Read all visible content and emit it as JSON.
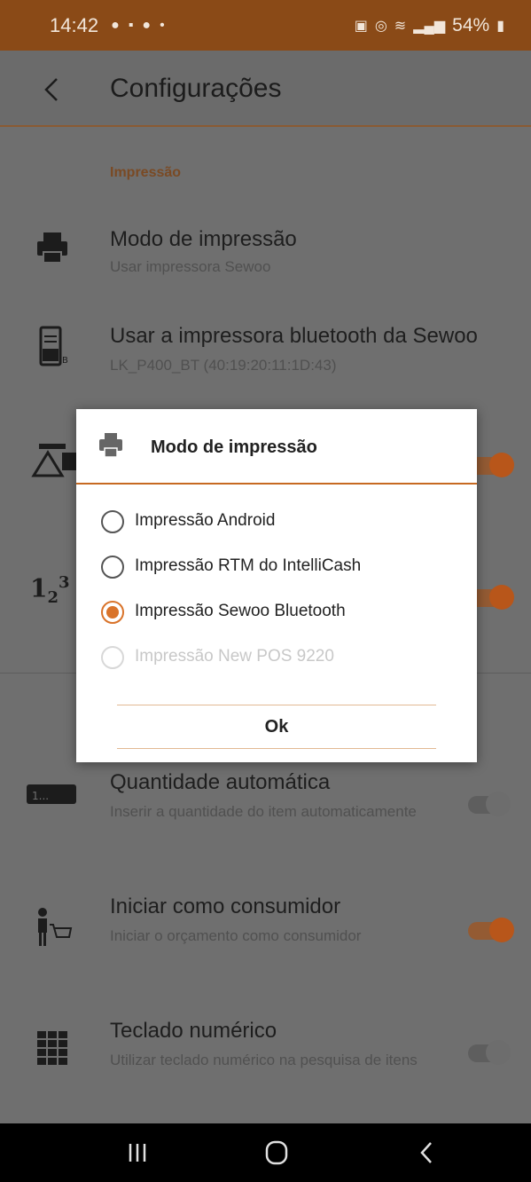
{
  "status_bar": {
    "time": "14:42",
    "battery": "54%"
  },
  "app_bar": {
    "title": "Configurações"
  },
  "section": {
    "header": "Impressão"
  },
  "settings": [
    {
      "title": "Modo de impressão",
      "subtitle": "Usar impressora Sewoo",
      "icon": "printer-icon"
    },
    {
      "title": "Usar a impressora bluetooth da Sewoo",
      "subtitle": "LK_P400_BT (40:19:20:11:1D:43)",
      "icon": "bluetooth-printer-icon"
    },
    {
      "title": "Quantidade automática",
      "subtitle": "Inserir a quantidade do item automaticamente",
      "icon": "keyboard-number-icon",
      "toggle": false
    },
    {
      "title": "Iniciar como consumidor",
      "subtitle": "Iniciar o orçamento como consumidor",
      "icon": "consumer-cart-icon",
      "toggle": true
    },
    {
      "title": "Teclado numérico",
      "subtitle": "Utilizar teclado numérico na pesquisa de itens",
      "icon": "numeric-keypad-icon",
      "toggle": false
    }
  ],
  "hidden_toggles": [
    true,
    true
  ],
  "dialog": {
    "title": "Modo de impressão",
    "options": [
      {
        "label": "Impressão Android",
        "checked": false,
        "enabled": true
      },
      {
        "label": "Impressão RTM do IntelliCash",
        "checked": false,
        "enabled": true
      },
      {
        "label": "Impressão Sewoo Bluetooth",
        "checked": true,
        "enabled": true
      },
      {
        "label": "Impressão New POS 9220",
        "checked": false,
        "enabled": false
      }
    ],
    "ok_label": "Ok"
  },
  "colors": {
    "accent": "#d9732a",
    "status_bar": "#8a4a17"
  }
}
